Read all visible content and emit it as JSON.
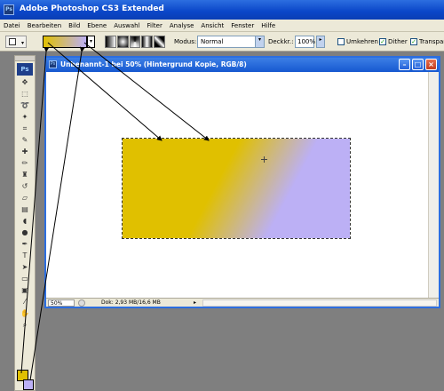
{
  "app": {
    "title": "Adobe Photoshop CS3 Extended",
    "icon_text": "Ps"
  },
  "menu": [
    "Datei",
    "Bearbeiten",
    "Bild",
    "Ebene",
    "Auswahl",
    "Filter",
    "Analyse",
    "Ansicht",
    "Fenster",
    "Hilfe"
  ],
  "options": {
    "mode_label": "Modus:",
    "mode_value": "Normal",
    "opacity_label": "Deckkr.:",
    "opacity_value": "100%",
    "reverse_label": "Umkehren",
    "dither_label": "Dither",
    "transparency_label": "Transparenz",
    "reverse_checked": false,
    "dither_checked": true,
    "transparency_checked": true
  },
  "colors": {
    "foreground": "#e0c000",
    "background": "#bcb0f5",
    "gradient_start": "#e0c000",
    "gradient_end": "#bcb0f5"
  },
  "toolbox": {
    "logo": "Ps"
  },
  "document": {
    "title": "Unbenannt-1 bei 50% (Hintergrund Kopie, RGB/8)",
    "zoom": "50%",
    "info": "Dok: 2,93 MB/16,6 MB"
  }
}
